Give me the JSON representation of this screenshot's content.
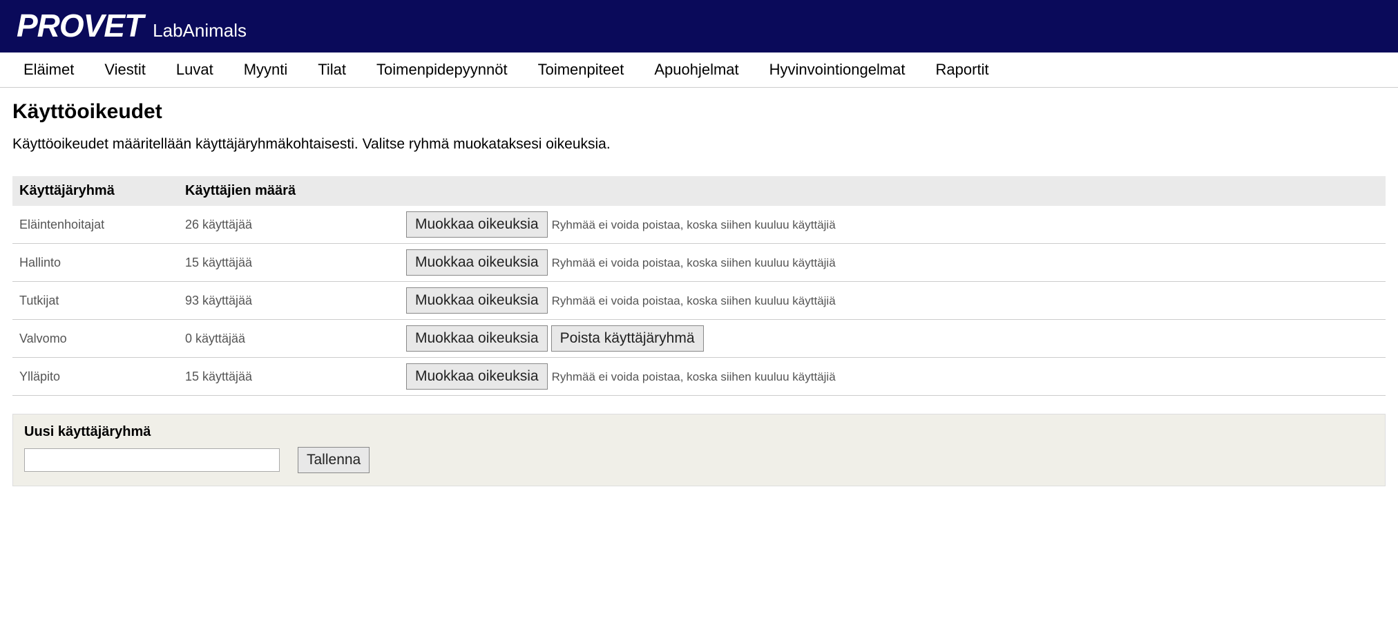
{
  "header": {
    "logo": "PROVET",
    "subtitle": "LabAnimals"
  },
  "nav": {
    "items": [
      "Eläimet",
      "Viestit",
      "Luvat",
      "Myynti",
      "Tilat",
      "Toimenpidepyynnöt",
      "Toimenpiteet",
      "Apuohjelmat",
      "Hyvinvointiongelmat",
      "Raportit"
    ]
  },
  "page": {
    "title": "Käyttöoikeudet",
    "description": "Käyttöoikeudet määritellään käyttäjäryhmäkohtaisesti. Valitse ryhmä muokataksesi oikeuksia."
  },
  "table": {
    "headers": {
      "group": "Käyttäjäryhmä",
      "count": "Käyttäjien määrä"
    },
    "edit_label": "Muokkaa oikeuksia",
    "delete_label": "Poista käyttäjäryhmä",
    "cannot_delete_note": "Ryhmää ei voida poistaa, koska siihen kuuluu käyttäjiä",
    "rows": [
      {
        "name": "Eläintenhoitajat",
        "count": "26 käyttäjää",
        "deletable": false
      },
      {
        "name": "Hallinto",
        "count": "15 käyttäjää",
        "deletable": false
      },
      {
        "name": "Tutkijat",
        "count": "93 käyttäjää",
        "deletable": false
      },
      {
        "name": "Valvomo",
        "count": "0 käyttäjää",
        "deletable": true
      },
      {
        "name": "Ylläpito",
        "count": "15 käyttäjää",
        "deletable": false
      }
    ]
  },
  "new_group": {
    "title": "Uusi käyttäjäryhmä",
    "input_value": "",
    "save_label": "Tallenna"
  }
}
